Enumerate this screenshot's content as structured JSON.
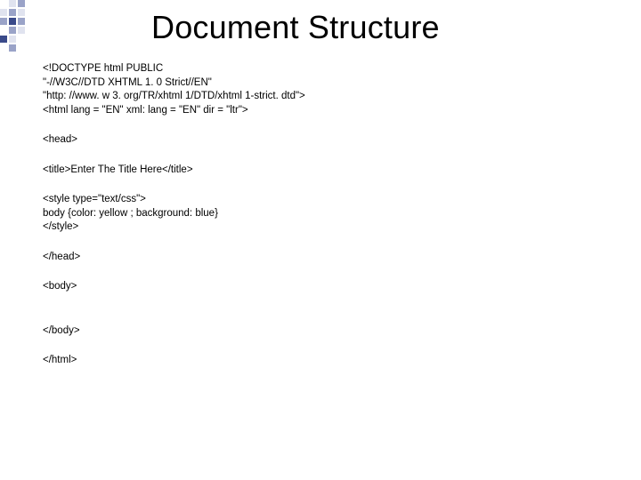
{
  "title": "Document Structure",
  "blocks": {
    "b1": "<!DOCTYPE html PUBLIC\n\"-//W3C//DTD XHTML 1. 0 Strict//EN\"\n\"http: //www. w 3. org/TR/xhtml 1/DTD/xhtml 1-strict. dtd\">\n<html lang = \"EN\" xml: lang = \"EN\" dir = \"ltr\">",
    "b2": "<head>",
    "b3": "<title>Enter The Title Here</title>",
    "b4": "<style type=\"text/css\">\nbody {color: yellow ; background: blue}\n</style>",
    "b5": "</head>",
    "b6": "<body>",
    "b7": "</body>",
    "b8": "</html>"
  }
}
